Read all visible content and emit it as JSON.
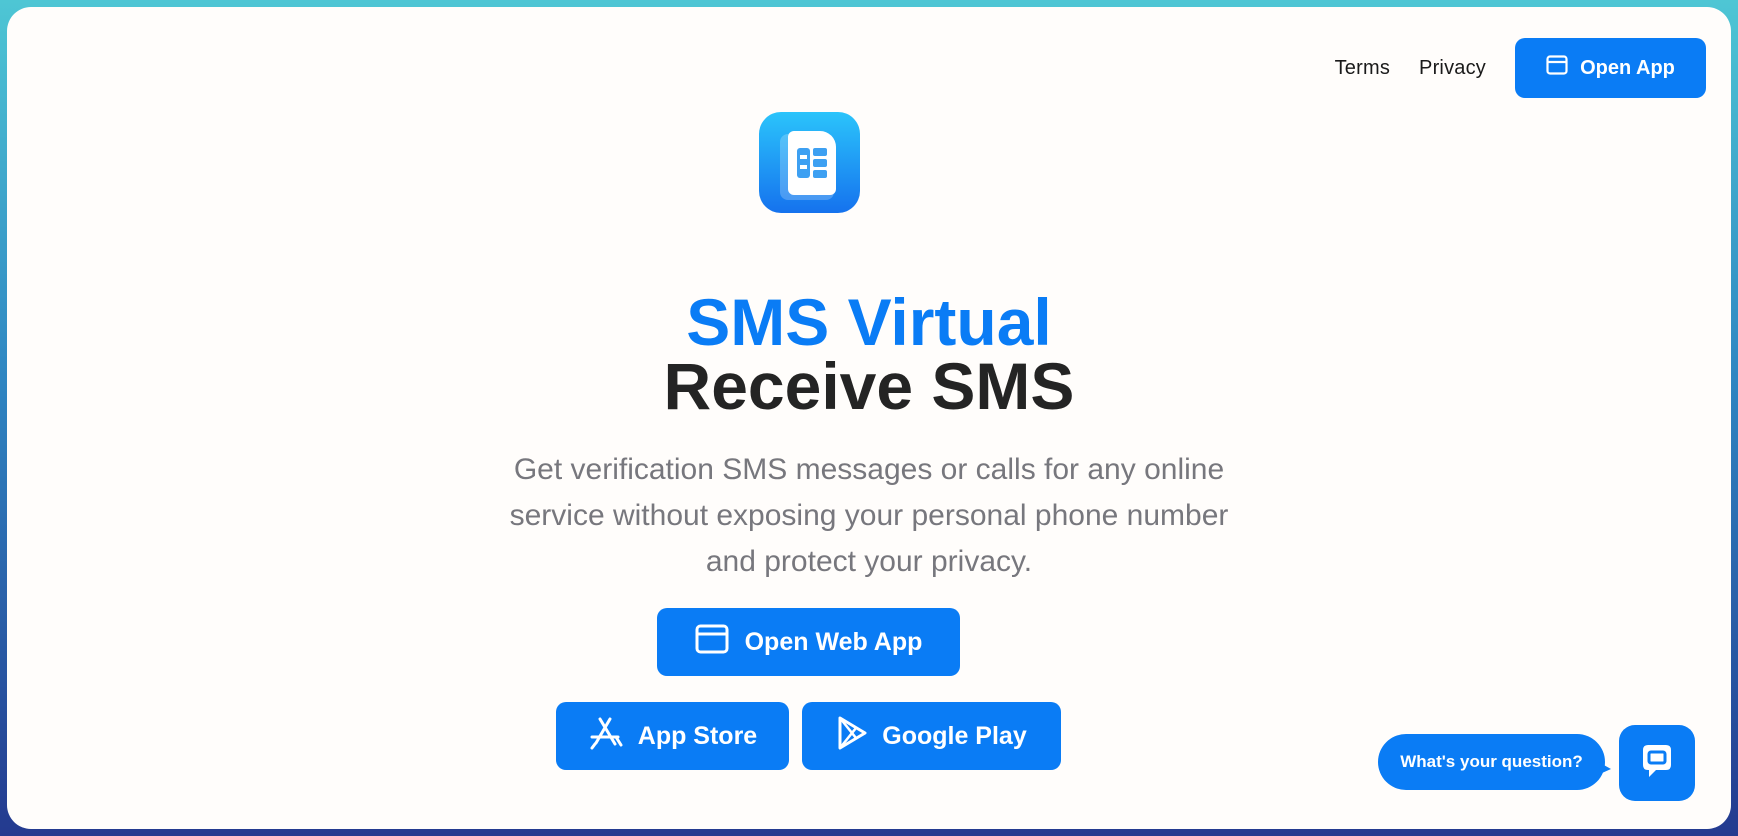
{
  "nav": {
    "terms_label": "Terms",
    "privacy_label": "Privacy",
    "open_app_label": "Open App"
  },
  "hero": {
    "title_line1": "SMS Virtual",
    "title_line2": "Receive SMS",
    "subtitle_line1": "Get verification SMS messages or calls for any online",
    "subtitle_line2": "service without exposing your personal phone number",
    "subtitle_line3": "and protect your privacy."
  },
  "actions": {
    "open_web_app_label": "Open Web App",
    "app_store_label": "App Store",
    "google_play_label": "Google Play"
  },
  "chat": {
    "prompt": "What's your question?"
  },
  "colors": {
    "accent": "#0a7cf5",
    "title_dark": "#242424",
    "subtitle_gray": "#77777d"
  },
  "icons": {
    "logo": "sim-card-icon",
    "open_app": "browser-window-icon",
    "open_web_app": "browser-window-icon",
    "app_store": "app-store-icon",
    "google_play": "google-play-icon",
    "chat": "chat-icon"
  }
}
